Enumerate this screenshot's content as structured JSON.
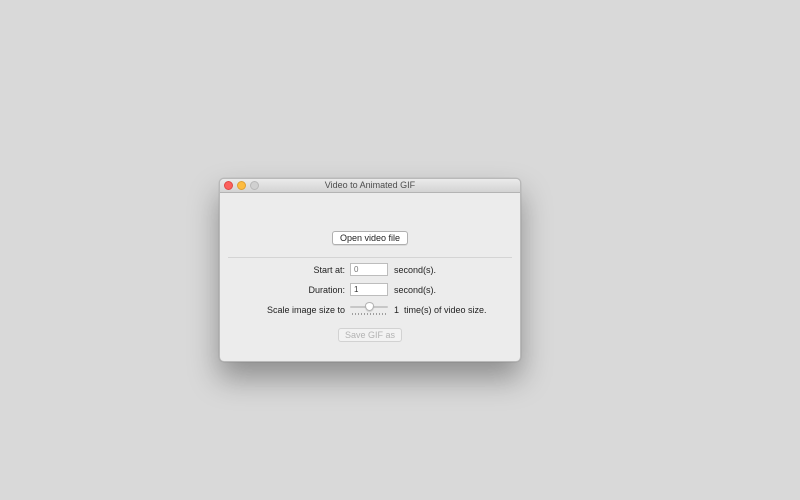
{
  "window": {
    "title": "Video to Animated GIF"
  },
  "open_button": {
    "label": "Open video file"
  },
  "start": {
    "label": "Start at:",
    "placeholder": "0",
    "unit": "second(s)."
  },
  "duration": {
    "label": "Duration:",
    "value": "1",
    "unit": "second(s)."
  },
  "scale": {
    "label": "Scale image size to",
    "value": "1",
    "unit": "time(s) of video size.",
    "slider_level": 0.5
  },
  "save_button": {
    "label": "Save GIF as",
    "enabled": false
  },
  "colors": {
    "desktop": "#d9d9d9",
    "window_bg": "#ececec",
    "close": "#fc605c",
    "minimize": "#fdbc40",
    "zoom_disabled": "#d0d0d0"
  }
}
